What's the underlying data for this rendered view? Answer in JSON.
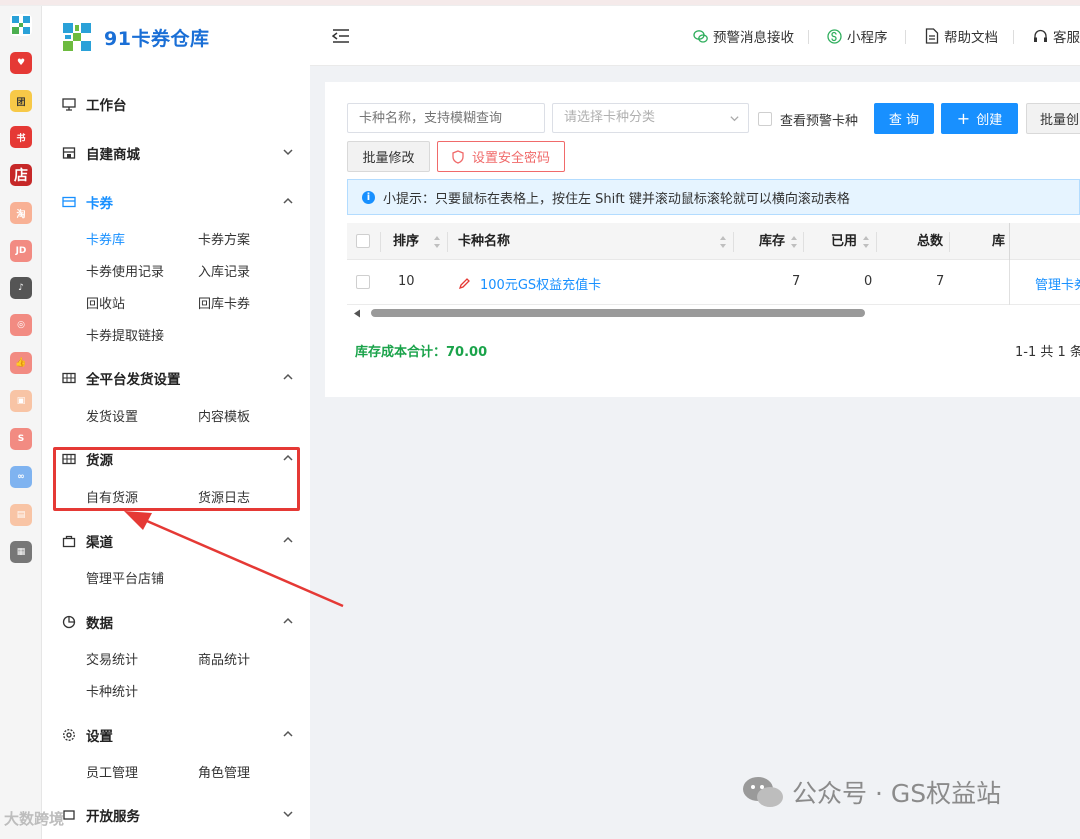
{
  "app": {
    "title": "91卡券仓库"
  },
  "header": {
    "items": [
      "预警消息接收",
      "小程序",
      "帮助文档",
      "客服"
    ]
  },
  "menu": {
    "workbench": "工作台",
    "mall": "自建商城",
    "coupons": "卡券",
    "coupons_sub": [
      "卡券库",
      "卡券方案",
      "卡券使用记录",
      "入库记录",
      "回收站",
      "回库卡券",
      "卡券提取链接"
    ],
    "delivery": "全平台发货设置",
    "delivery_sub": [
      "发货设置",
      "内容模板"
    ],
    "source": "货源",
    "source_sub": [
      "自有货源",
      "货源日志"
    ],
    "channel": "渠道",
    "channel_sub": [
      "管理平台店铺"
    ],
    "data": "数据",
    "data_sub": [
      "交易统计",
      "商品统计",
      "卡种统计"
    ],
    "settings": "设置",
    "settings_sub": [
      "员工管理",
      "角色管理"
    ],
    "open": "开放服务"
  },
  "toolbar": {
    "name_placeholder": "卡种名称，支持模糊查询",
    "category_placeholder": "请选择卡种分类",
    "warning_checkbox": "查看预警卡种",
    "query": "查 询",
    "create": "创建",
    "batch_create": "批量创",
    "batch_edit": "批量修改",
    "security_password": "设置安全密码"
  },
  "tip": "小提示：只要鼠标在表格上，按住左 Shift 键并滚动鼠标滚轮就可以横向滚动表格",
  "table": {
    "columns": [
      "排序",
      "卡种名称",
      "库存",
      "已用",
      "总数",
      "库"
    ],
    "rows": [
      {
        "sort": "10",
        "name": "100元GS权益充值卡",
        "stock": "7",
        "used": "0",
        "total": "7",
        "action": "管理卡券"
      }
    ]
  },
  "summary": "库存成本合计：70.00",
  "pager": "1-1 共 1 条",
  "watermark": {
    "right": "公众号 · GS权益站",
    "left": "大数跨境"
  },
  "colors": {
    "primary": "#1890ff",
    "highlight": "#e53935",
    "summary": "#1aa34a"
  }
}
